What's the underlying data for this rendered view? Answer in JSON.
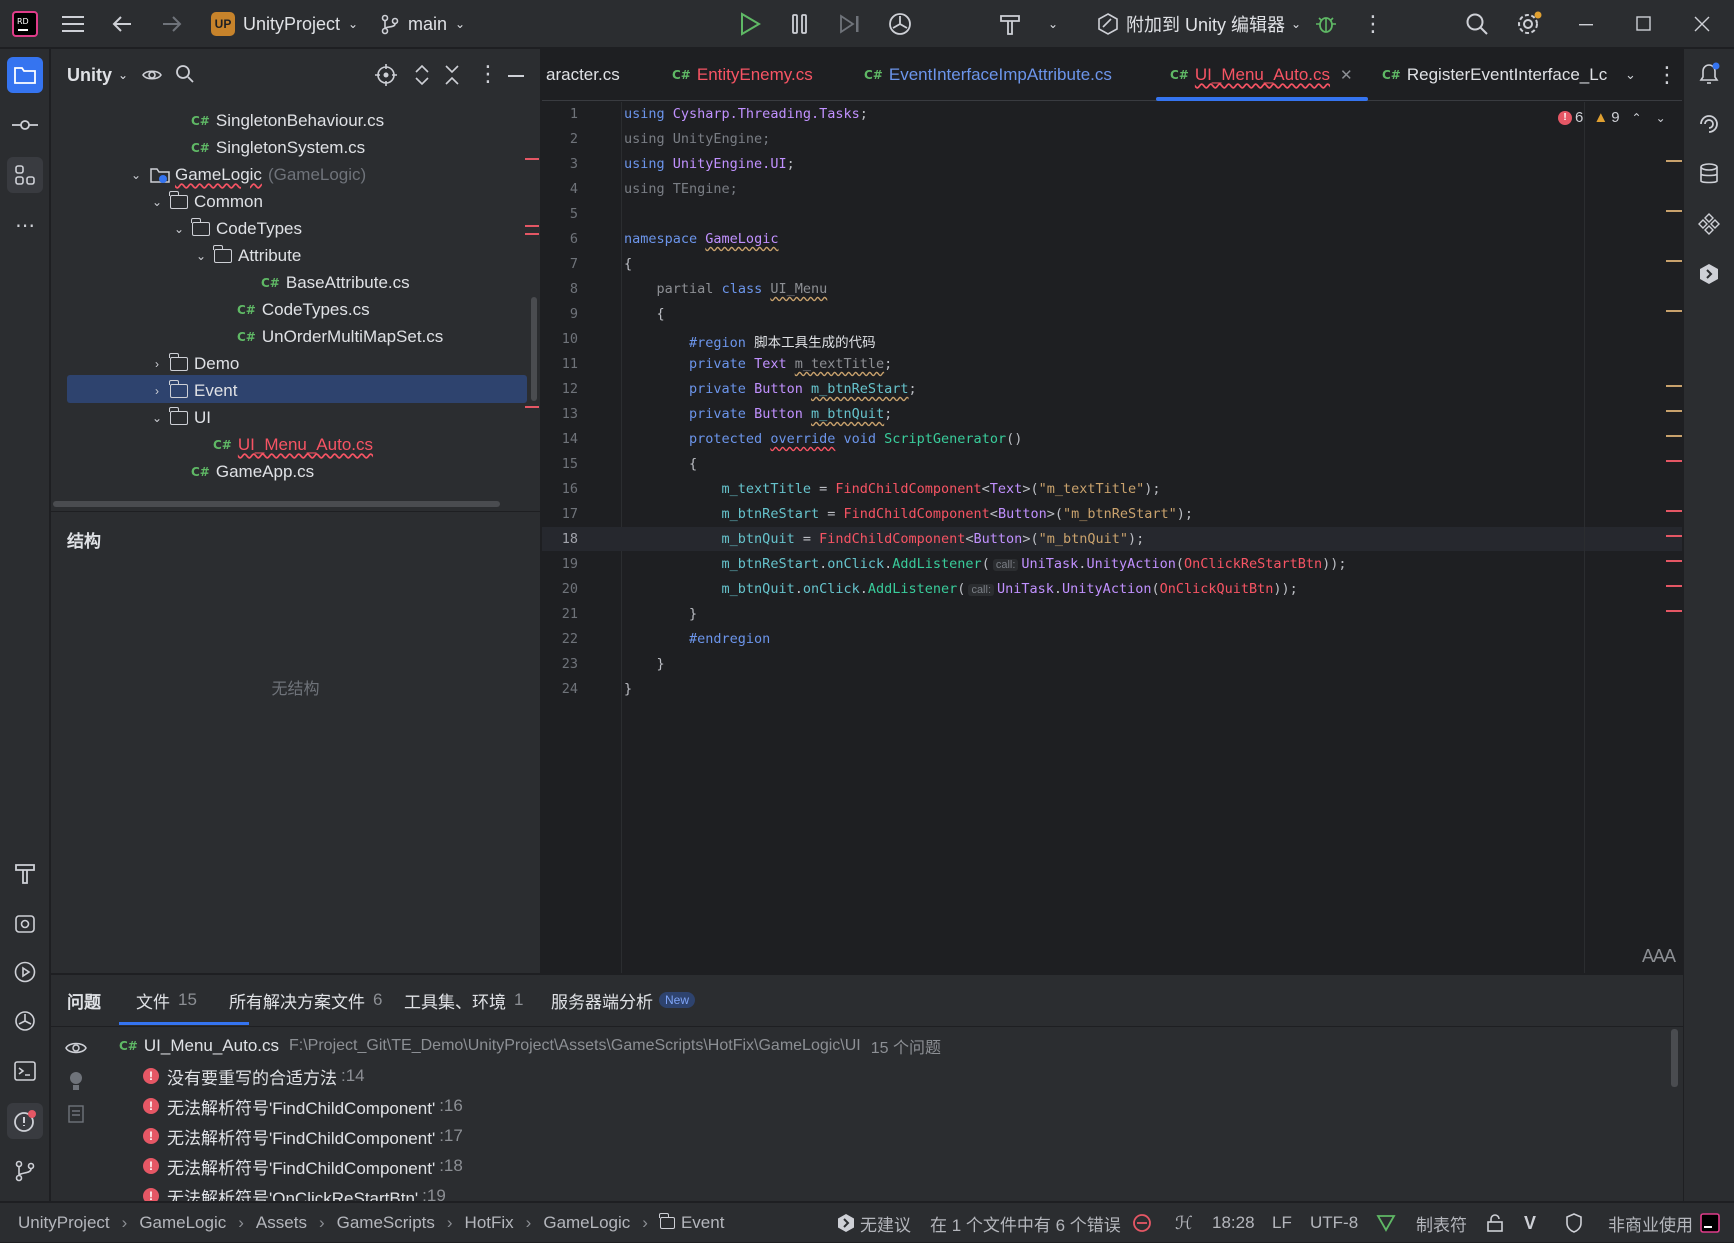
{
  "window": {
    "project_badge": "UP",
    "project_name": "UnityProject",
    "branch": "main",
    "attach_label": "附加到 Unity 编辑器"
  },
  "project_panel": {
    "title": "Unity",
    "tree": [
      {
        "type": "file",
        "label": "SingletonBehaviour.cs",
        "depth": 5
      },
      {
        "type": "file",
        "label": "SingletonSystem.cs",
        "depth": 5
      },
      {
        "type": "folder",
        "label": "GameLogic",
        "suffix": "(GameLogic)",
        "expanded": true
      },
      {
        "type": "folder",
        "label": "Common",
        "expanded": true
      },
      {
        "type": "folder",
        "label": "CodeTypes",
        "expanded": true
      },
      {
        "type": "folder",
        "label": "Attribute",
        "expanded": true
      },
      {
        "type": "file",
        "label": "BaseAttribute.cs"
      },
      {
        "type": "file",
        "label": "CodeTypes.cs"
      },
      {
        "type": "file",
        "label": "UnOrderMultiMapSet.cs"
      },
      {
        "type": "folder",
        "label": "Demo",
        "expanded": false
      },
      {
        "type": "folder",
        "label": "Event",
        "expanded": false,
        "selected": true
      },
      {
        "type": "folder",
        "label": "UI",
        "expanded": true
      },
      {
        "type": "file",
        "label": "UI_Menu_Auto.cs",
        "error": true
      },
      {
        "type": "file",
        "label": "GameApp.cs"
      }
    ],
    "structure_title": "结构",
    "structure_empty": "无结构"
  },
  "tabs": [
    {
      "label": "aracter.cs",
      "active": false,
      "error": false
    },
    {
      "label": "EntityEnemy.cs",
      "active": false,
      "error": true
    },
    {
      "label": "EventInterfaceImpAttribute.cs",
      "active": false,
      "error": true
    },
    {
      "label": "UI_Menu_Auto.cs",
      "active": true,
      "error": true
    },
    {
      "label": "RegisterEventInterface_Lc",
      "active": false,
      "error": false
    }
  ],
  "editor": {
    "errors_count": "6",
    "warnings_count": "9",
    "line_numbers": [
      "1",
      "2",
      "3",
      "4",
      "5",
      "6",
      "7",
      "8",
      "9",
      "10",
      "11",
      "12",
      "13",
      "14",
      "15",
      "16",
      "17",
      "18",
      "19",
      "20",
      "21",
      "22",
      "23",
      "24"
    ],
    "current_line": 18,
    "reader_mode": "AAA"
  },
  "problems": {
    "tabs": [
      {
        "label": "问题",
        "count": ""
      },
      {
        "label": "文件",
        "count": "15"
      },
      {
        "label": "所有解决方案文件",
        "count": "6"
      },
      {
        "label": "工具集、环境",
        "count": "1"
      },
      {
        "label": "服务器端分析",
        "count": "",
        "badge": "New"
      }
    ],
    "file": "UI_Menu_Auto.cs",
    "path": "F:\\Project_Git\\TE_Demo\\UnityProject\\Assets\\GameScripts\\HotFix\\GameLogic\\UI",
    "summary": "15 个问题",
    "items": [
      {
        "text": "没有要重写的合适方法",
        "line": ":14"
      },
      {
        "text": "无法解析符号'FindChildComponent'",
        "line": ":16"
      },
      {
        "text": "无法解析符号'FindChildComponent'",
        "line": ":17"
      },
      {
        "text": "无法解析符号'FindChildComponent'",
        "line": ":18"
      },
      {
        "text": "无法解析符号'OnClickReStartBtn'",
        "line": ":19"
      }
    ]
  },
  "statusbar": {
    "breadcrumb": [
      "UnityProject",
      "GameLogic",
      "Assets",
      "GameScripts",
      "HotFix",
      "GameLogic",
      "Event"
    ],
    "no_suggestions": "无建议",
    "errors_text": "在 1 个文件中有 6 个错误",
    "position": "18:28",
    "line_sep": "LF",
    "encoding": "UTF-8",
    "indent": "制表符",
    "license": "非商业使用"
  }
}
